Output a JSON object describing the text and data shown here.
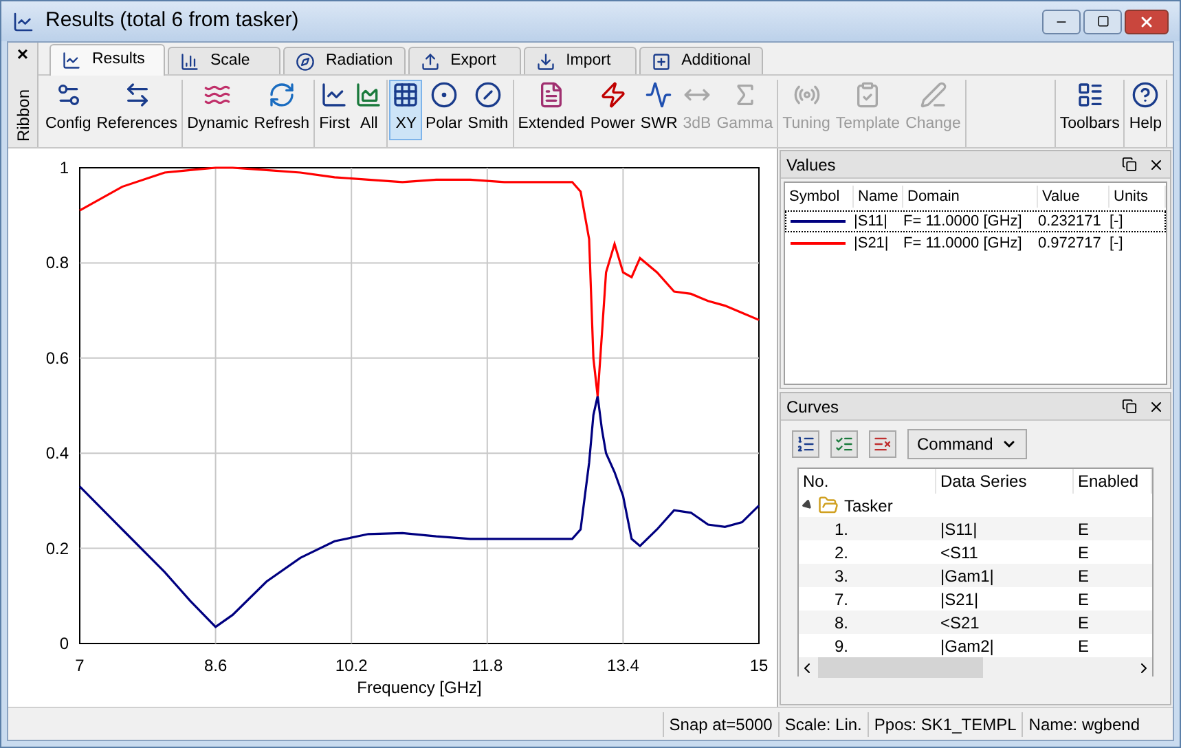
{
  "window": {
    "title": "Results (total 6 from tasker)"
  },
  "ribbon": {
    "label": "Ribbon",
    "close": "×",
    "tabs": [
      {
        "label": "Results",
        "selected": true
      },
      {
        "label": "Scale",
        "selected": false
      },
      {
        "label": "Radiation",
        "selected": false
      },
      {
        "label": "Export",
        "selected": false
      },
      {
        "label": "Import",
        "selected": false
      },
      {
        "label": "Additional",
        "selected": false
      }
    ],
    "groups": [
      [
        {
          "label": "Config",
          "disabled": false,
          "selected": false
        },
        {
          "label": "References",
          "disabled": false,
          "selected": false
        }
      ],
      [
        {
          "label": "Dynamic",
          "disabled": false,
          "selected": false
        },
        {
          "label": "Refresh",
          "disabled": false,
          "selected": false
        }
      ],
      [
        {
          "label": "First",
          "disabled": false,
          "selected": false
        },
        {
          "label": "All",
          "disabled": false,
          "selected": false
        }
      ],
      [
        {
          "label": "XY",
          "disabled": false,
          "selected": true
        },
        {
          "label": "Polar",
          "disabled": false,
          "selected": false
        },
        {
          "label": "Smith",
          "disabled": false,
          "selected": false
        }
      ],
      [
        {
          "label": "Extended",
          "disabled": false,
          "selected": false
        },
        {
          "label": "Power",
          "disabled": false,
          "selected": false
        },
        {
          "label": "SWR",
          "disabled": false,
          "selected": false
        },
        {
          "label": "3dB",
          "disabled": true,
          "selected": false
        },
        {
          "label": "Gamma",
          "disabled": true,
          "selected": false
        }
      ],
      [
        {
          "label": "Tuning",
          "disabled": true,
          "selected": false
        },
        {
          "label": "Template",
          "disabled": true,
          "selected": false
        },
        {
          "label": "Change",
          "disabled": true,
          "selected": false
        }
      ],
      [
        {
          "label": "Toolbars",
          "disabled": false,
          "selected": false
        }
      ],
      [
        {
          "label": "Help",
          "disabled": false,
          "selected": false
        }
      ]
    ]
  },
  "plot": {
    "chart_data": {
      "type": "line",
      "xlabel": "Frequency [GHz]",
      "x": [
        7,
        7.5,
        8,
        8.3,
        8.6,
        8.8,
        9.2,
        9.6,
        10,
        10.4,
        10.8,
        11.2,
        11.6,
        12,
        12.4,
        12.8,
        12.9,
        13,
        13.05,
        13.1,
        13.15,
        13.2,
        13.3,
        13.4,
        13.5,
        13.6,
        13.8,
        14,
        14.2,
        14.4,
        14.6,
        14.8,
        15
      ],
      "series": [
        {
          "color": "#000080",
          "values": [
            0.33,
            0.24,
            0.15,
            0.09,
            0.035,
            0.06,
            0.13,
            0.18,
            0.215,
            0.23,
            0.232,
            0.225,
            0.22,
            0.22,
            0.22,
            0.22,
            0.24,
            0.38,
            0.48,
            0.52,
            0.45,
            0.4,
            0.36,
            0.31,
            0.22,
            0.205,
            0.24,
            0.28,
            0.275,
            0.25,
            0.245,
            0.255,
            0.29
          ]
        },
        {
          "color": "#ff0000",
          "values": [
            0.91,
            0.96,
            0.99,
            0.995,
            1.0,
            1.0,
            0.995,
            0.99,
            0.98,
            0.975,
            0.97,
            0.975,
            0.975,
            0.97,
            0.97,
            0.97,
            0.95,
            0.85,
            0.6,
            0.52,
            0.65,
            0.78,
            0.84,
            0.78,
            0.77,
            0.81,
            0.78,
            0.74,
            0.735,
            0.72,
            0.71,
            0.695,
            0.68
          ]
        }
      ],
      "grid": true,
      "xlim": [
        7,
        15
      ],
      "ylim": [
        0,
        1
      ],
      "xticks": [
        7,
        8.6,
        10.2,
        11.8,
        13.4,
        15
      ],
      "yticks": [
        0,
        0.2,
        0.4,
        0.6,
        0.8,
        1
      ]
    }
  },
  "values_panel": {
    "title": "Values",
    "columns": [
      "Symbol",
      "Name",
      "Domain",
      "Value",
      "Units"
    ],
    "rows": [
      {
        "color": "#000080",
        "name": "|S11|",
        "domain": "F= 11.0000 [GHz]",
        "value": "0.232171",
        "units": "[-]",
        "selected": true
      },
      {
        "color": "#ff0000",
        "name": "|S21|",
        "domain": "F= 11.0000 [GHz]",
        "value": "0.972717",
        "units": "[-]",
        "selected": false
      }
    ]
  },
  "curves_panel": {
    "title": "Curves",
    "command": "Command",
    "columns": [
      "No.",
      "Data Series",
      "Enabled"
    ],
    "tree": [
      {
        "label": "Tasker",
        "expanded": true,
        "children": [
          {
            "no": "1.",
            "series": "|S11|",
            "enabled": "E"
          },
          {
            "no": "2.",
            "series": "<S11",
            "enabled": "E"
          },
          {
            "no": "3.",
            "series": "|Gam1|",
            "enabled": "E"
          },
          {
            "no": "7.",
            "series": "|S21|",
            "enabled": "E"
          },
          {
            "no": "8.",
            "series": "<S21",
            "enabled": "E"
          },
          {
            "no": "9.",
            "series": "|Gam2|",
            "enabled": "E"
          }
        ]
      }
    ]
  },
  "status_bar": [
    "Snap at=5000",
    "Scale: Lin.",
    "Ppos: SK1_TEMPL",
    "Name: wgbend"
  ]
}
